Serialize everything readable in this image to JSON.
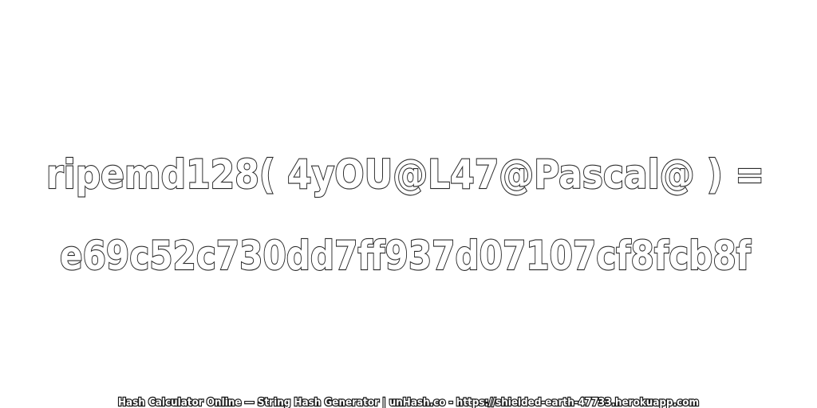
{
  "expression": {
    "line1": "ripemd128( 4yOU@L47@Pascal@ ) =",
    "line2": "e69c52c730dd7ff937d07107cf8fcb8f"
  },
  "footer": {
    "text": "Hash Calculator Online — String Hash Generator | unHash.co - https://shielded-earth-47733.herokuapp.com"
  },
  "colors": {
    "background": "#ffffff",
    "text_fill": "#ffffff",
    "text_stroke": "#2a2a2a"
  }
}
